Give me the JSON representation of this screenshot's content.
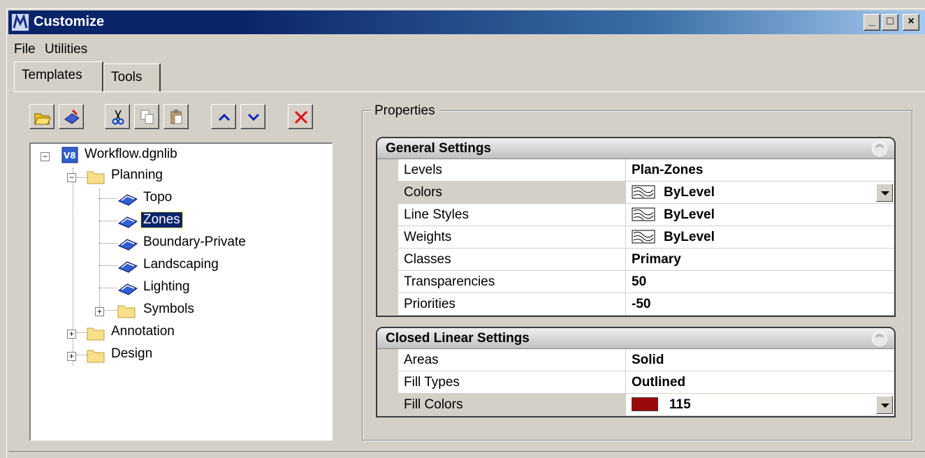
{
  "window": {
    "title": "Customize",
    "controls": [
      "_",
      "□",
      "×"
    ]
  },
  "menu": [
    "File",
    "Utilities"
  ],
  "tabs": [
    {
      "label": "Templates",
      "active": true
    },
    {
      "label": "Tools",
      "active": false
    }
  ],
  "toolbar": [
    {
      "icon": "open-folder-icon"
    },
    {
      "icon": "template-icon"
    },
    {
      "icon": "cut-icon"
    },
    {
      "icon": "copy-icon"
    },
    {
      "icon": "paste-icon"
    },
    {
      "icon": "move-up-icon"
    },
    {
      "icon": "move-down-icon"
    },
    {
      "icon": "delete-icon"
    }
  ],
  "tree": {
    "root": "Workflow.dgnlib",
    "planning": "Planning",
    "topo": "Topo",
    "zones": "Zones",
    "boundary": "Boundary-Private",
    "landscaping": "Landscaping",
    "lighting": "Lighting",
    "symbols": "Symbols",
    "annotation": "Annotation",
    "design": "Design"
  },
  "properties": {
    "group_label": "Properties",
    "general": {
      "title": "General Settings",
      "levels_name": "Levels",
      "levels_value": "Plan-Zones",
      "colors_name": "Colors",
      "colors_value": "ByLevel",
      "linestyles_name": "Line Styles",
      "linestyles_value": "ByLevel",
      "weights_name": "Weights",
      "weights_value": "ByLevel",
      "classes_name": "Classes",
      "classes_value": "Primary",
      "transparencies_name": "Transparencies",
      "transparencies_value": "50",
      "priorities_name": "Priorities",
      "priorities_value": "-50"
    },
    "closed": {
      "title": "Closed Linear Settings",
      "areas_name": "Areas",
      "areas_value": "Solid",
      "filltypes_name": "Fill Types",
      "filltypes_value": "Outlined",
      "fillcolors_name": "Fill Colors",
      "fillcolors_value": "115",
      "fill_color_hex": "#9a0a0a"
    }
  }
}
